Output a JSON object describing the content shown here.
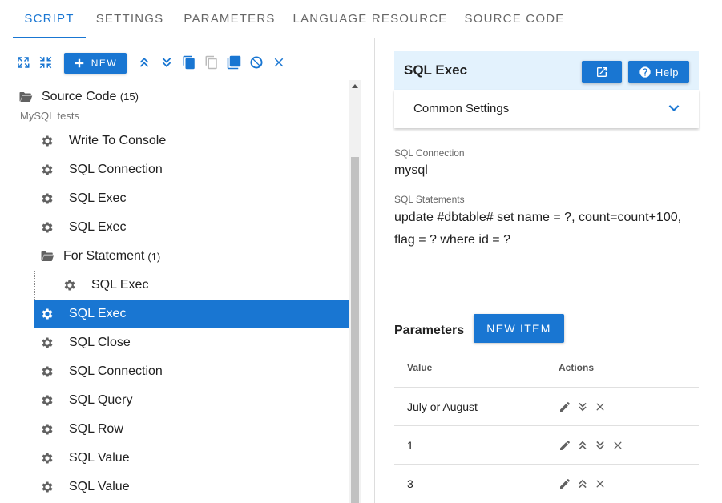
{
  "tabs": [
    "Script",
    "Settings",
    "Parameters",
    "Language Resource",
    "Source Code"
  ],
  "toolbar": {
    "new_label": "New",
    "icons": [
      "expand-all-icon",
      "collapse-all-icon",
      "new-icon",
      "move-up-icon",
      "move-down-icon",
      "copy-icon",
      "paste-icon",
      "duplicate-icon",
      "disable-icon",
      "delete-icon"
    ]
  },
  "tree": {
    "root_label": "Source Code",
    "root_count": "(15)",
    "root_subtitle": "MySQL tests",
    "nodes": [
      {
        "label": "Write To Console"
      },
      {
        "label": "SQL Connection"
      },
      {
        "label": "SQL Exec"
      },
      {
        "label": "SQL Exec"
      },
      {
        "label": "For Statement",
        "count": "(1)",
        "type": "folder"
      },
      {
        "label": "SQL Exec",
        "child": true
      },
      {
        "label": "SQL Exec",
        "selected": true
      },
      {
        "label": "SQL Close"
      },
      {
        "label": "SQL Connection"
      },
      {
        "label": "SQL Query"
      },
      {
        "label": "SQL Row"
      },
      {
        "label": "SQL Value"
      },
      {
        "label": "SQL Value"
      }
    ]
  },
  "detail": {
    "title": "SQL Exec",
    "help_label": "Help",
    "common_settings_label": "Common Settings",
    "connection_label": "SQL Connection",
    "connection_value": "mysql",
    "statements_label": "SQL Statements",
    "statements_value": "update #dbtable# set name = ?, count=count+100, flag = ? where id = ?",
    "parameters_label": "Parameters",
    "new_item_label": "New Item",
    "columns": [
      "Value",
      "Actions"
    ],
    "rows": [
      {
        "value": "July or August",
        "actions": [
          "edit",
          "move-down",
          "delete"
        ]
      },
      {
        "value": "1",
        "actions": [
          "edit",
          "move-up",
          "move-down",
          "delete"
        ]
      },
      {
        "value": "3",
        "actions": [
          "edit",
          "move-up",
          "delete"
        ]
      }
    ]
  },
  "colors": {
    "accent": "#1976d2",
    "header_bg": "#e3f2fd",
    "icon_gray": "#616161"
  }
}
